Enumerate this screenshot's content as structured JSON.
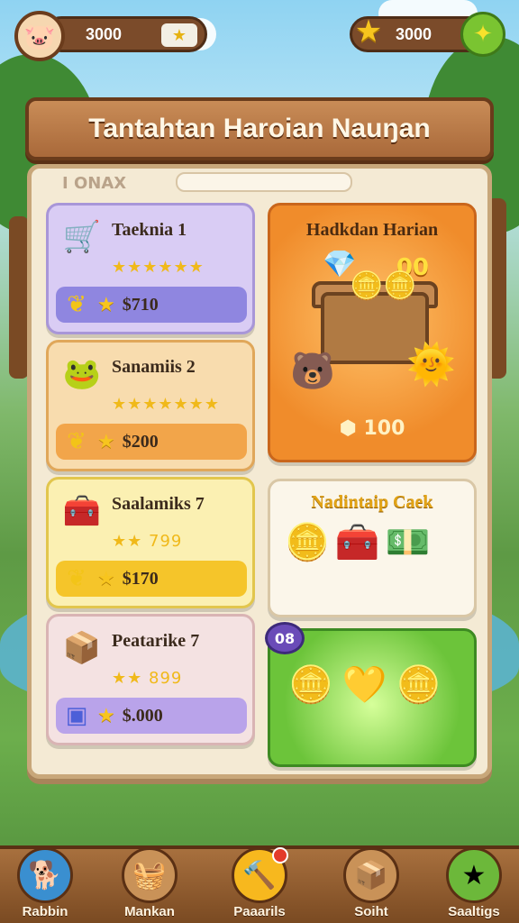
{
  "top_bar": {
    "left_currency": "3000",
    "right_currency": "3000"
  },
  "title": "Tantahtan Haroian Nauŋan",
  "panel": {
    "tag": "I ONAX"
  },
  "tasks": [
    {
      "name": "Taeknia 1",
      "stars": "★★★★★★",
      "reward": "$710"
    },
    {
      "name": "Sanamiis 2",
      "stars": "★★★★★★★",
      "reward": "$200"
    },
    {
      "name": "Saalamiks 7",
      "stars": "★★ 799",
      "reward": "$170"
    },
    {
      "name": "Peatarike 7",
      "stars": "★★ 899",
      "reward": "$.000"
    }
  ],
  "daily": {
    "title": "Hadkdan Harian",
    "count": "00",
    "reward": "100"
  },
  "shop": {
    "title": "Nadintaip Caek"
  },
  "bonus": {
    "badge": "08"
  },
  "nav": [
    {
      "label": "Rabbin",
      "icon": "dog-icon"
    },
    {
      "label": "Mankan",
      "icon": "shop-icon"
    },
    {
      "label": "Paaarils",
      "icon": "hammer-icon"
    },
    {
      "label": "Soiht",
      "icon": "box-icon"
    },
    {
      "label": "Saaltigs",
      "icon": "star-icon"
    }
  ],
  "colors": {
    "wood": "#a9693a",
    "panel": "#f4ead4",
    "gold": "#f7c51e",
    "orange_card": "#f08c2b",
    "green_card": "#6cc43a",
    "purple_card": "#cfc2f0",
    "peach_card": "#f7d9a8",
    "yellow_card": "#f9eba0",
    "pink_card": "#f2dde0"
  }
}
